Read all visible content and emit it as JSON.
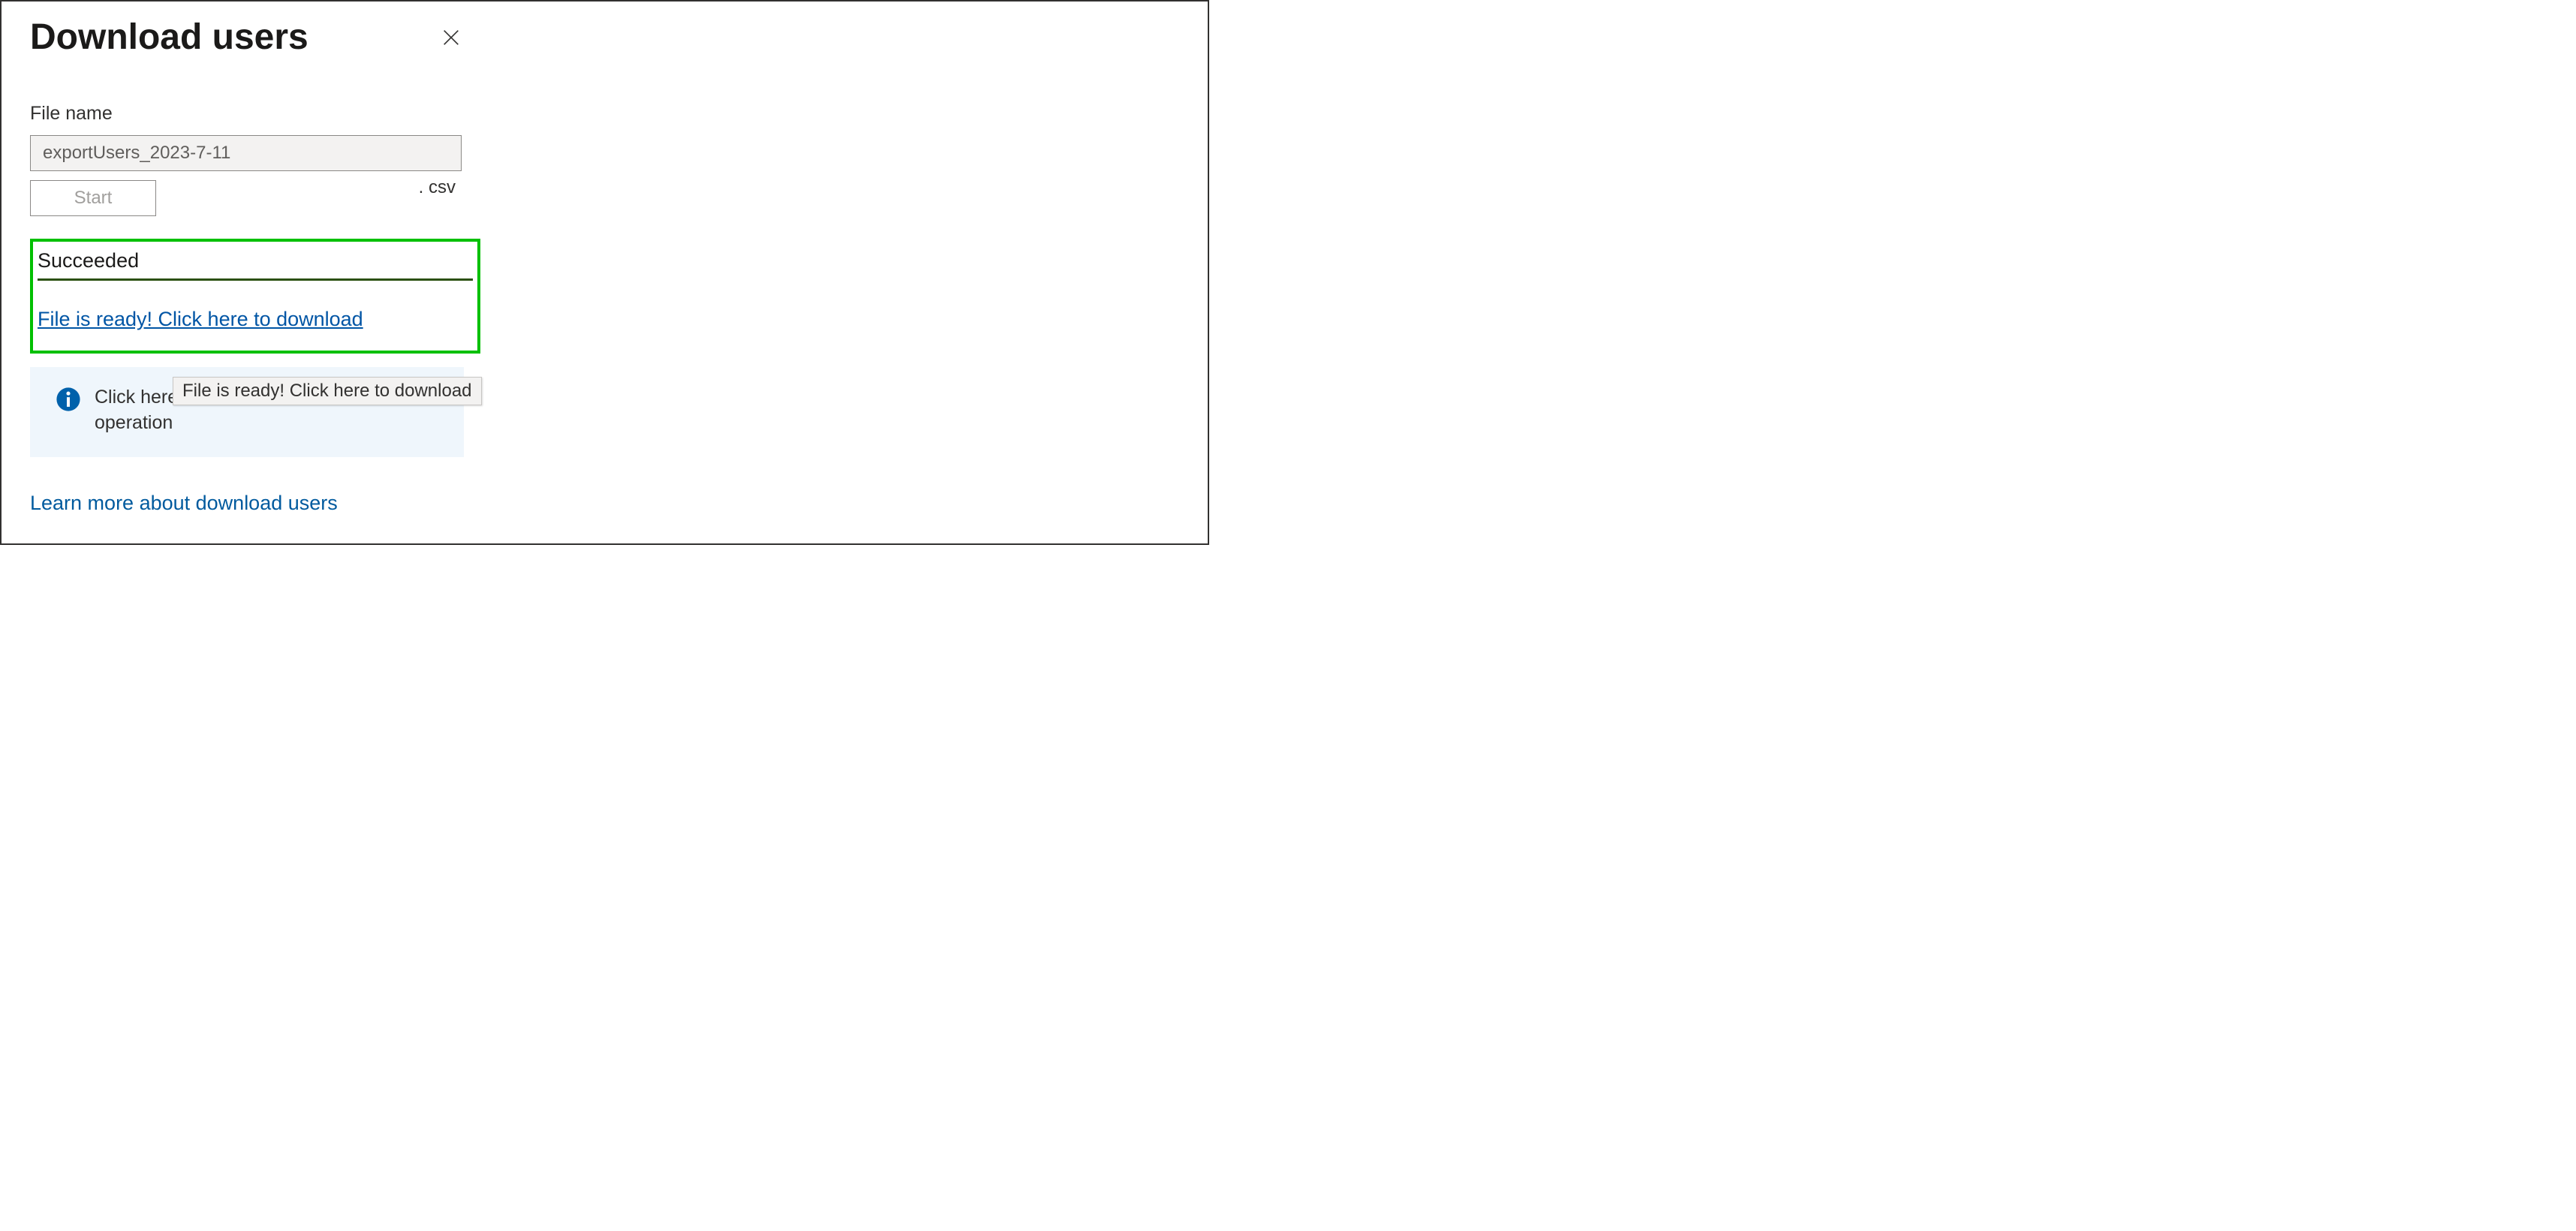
{
  "header": {
    "title": "Download users"
  },
  "form": {
    "filename_label": "File name",
    "filename_value": "exportUsers_2023-7-11",
    "extension": ". csv",
    "start_button": "Start"
  },
  "status": {
    "state": "Succeeded",
    "download_link": "File is ready! Click here to download"
  },
  "tooltip": {
    "text": "File is ready! Click here to download"
  },
  "info": {
    "message": "Click here to view the status of each operation"
  },
  "footer": {
    "learn_link": "Learn more about download users"
  }
}
